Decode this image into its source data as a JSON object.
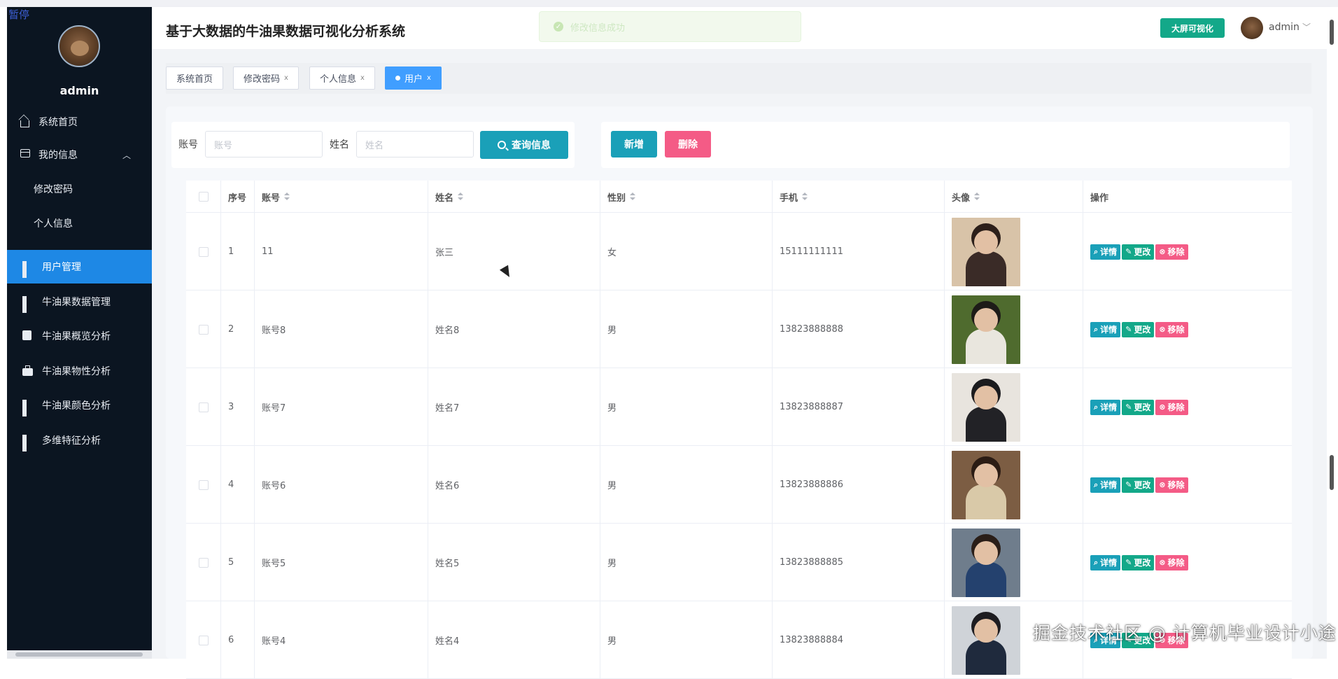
{
  "overlay": {
    "pause_label": "暂停"
  },
  "sidebar": {
    "username": "admin",
    "items": [
      {
        "label": "系统首页",
        "icon": "home-icon"
      },
      {
        "label": "我的信息",
        "icon": "user-box-icon"
      },
      {
        "label": "修改密码"
      },
      {
        "label": "个人信息"
      },
      {
        "label": "用户管理",
        "icon": "grid-icon",
        "active": true
      },
      {
        "label": "牛油果数据管理",
        "icon": "grid-icon"
      },
      {
        "label": "牛油果概览分析",
        "icon": "chart-icon"
      },
      {
        "label": "牛油果物性分析",
        "icon": "briefcase-icon"
      },
      {
        "label": "牛油果颜色分析",
        "icon": "grid-icon"
      },
      {
        "label": "多维特征分析",
        "icon": "grid-icon"
      }
    ]
  },
  "header": {
    "title": "基于大数据的牛油果数据可视化分析系统",
    "toast": "修改信息成功",
    "bigscreen_label": "大屏可视化",
    "user": "admin"
  },
  "tabs": [
    {
      "label": "系统首页"
    },
    {
      "label": "修改密码",
      "close": "x"
    },
    {
      "label": "个人信息",
      "close": "x"
    },
    {
      "label": "用户",
      "close": "x",
      "active": true
    }
  ],
  "search": {
    "account_label": "账号",
    "account_placeholder": "账号",
    "name_label": "姓名",
    "name_placeholder": "姓名",
    "query_label": "查询信息"
  },
  "actions": {
    "add_label": "新增",
    "delete_label": "删除"
  },
  "table": {
    "columns": {
      "index": "序号",
      "account": "账号",
      "name": "姓名",
      "gender": "性别",
      "phone": "手机",
      "avatar": "头像",
      "ops": "操作"
    },
    "op_labels": {
      "detail": "详情",
      "edit": "更改",
      "remove": "移除"
    },
    "rows": [
      {
        "index": "1",
        "account": "11",
        "name": "张三",
        "gender": "女",
        "phone": "15111111111"
      },
      {
        "index": "2",
        "account": "账号8",
        "name": "姓名8",
        "gender": "男",
        "phone": "13823888888"
      },
      {
        "index": "3",
        "account": "账号7",
        "name": "姓名7",
        "gender": "男",
        "phone": "13823888887"
      },
      {
        "index": "4",
        "account": "账号6",
        "name": "姓名6",
        "gender": "男",
        "phone": "13823888886"
      },
      {
        "index": "5",
        "account": "账号5",
        "name": "姓名5",
        "gender": "男",
        "phone": "13823888885"
      },
      {
        "index": "6",
        "account": "账号4",
        "name": "姓名4",
        "gender": "男",
        "phone": "13823888884"
      }
    ]
  },
  "watermark": "掘金技术社区 @ 计算机毕业设计小途",
  "colors": {
    "sidebar_bg": "#0b1521",
    "active_menu": "#1e88e5",
    "primary": "#1aa0b8",
    "success": "#13a889",
    "danger": "#f45b86",
    "tab_active": "#409eff"
  }
}
